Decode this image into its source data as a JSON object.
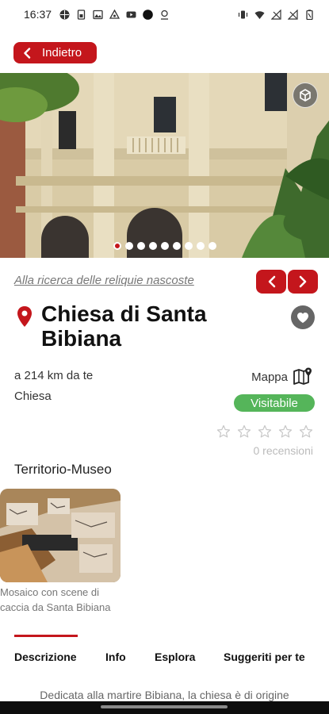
{
  "status_bar": {
    "time": "16:37",
    "left_icons": [
      "browser-icon",
      "sim-icon",
      "gallery-icon",
      "nfc-icon",
      "youtube-icon",
      "record-dot-icon",
      "location-icon"
    ],
    "right_icons": [
      "vibrate-icon",
      "wifi-icon",
      "signal-icon",
      "signal-2-icon",
      "battery-icon"
    ]
  },
  "back_button": {
    "label": "Indietro",
    "icon": "chevron-left-icon"
  },
  "carousel": {
    "total_images": 9,
    "active_index": 0,
    "fullscreen_icon": "cube-icon"
  },
  "route_link": "Alla ricerca delle reliquie nascoste",
  "poi": {
    "title": "Chiesa di Santa Bibiana",
    "distance": "a 214 km da te",
    "category": "Chiesa",
    "map_label": "Mappa",
    "status_badge": "Visitabile",
    "rating": 0,
    "max_rating": 5,
    "reviews": "0 recensioni"
  },
  "section": {
    "title": "Territorio-Museo",
    "items": [
      {
        "caption": "Mosaico con scene di caccia da Santa Bibiana"
      }
    ]
  },
  "tabs": [
    "Descrizione",
    "Info",
    "Esplora",
    "Suggeriti per te"
  ],
  "active_tab": 0,
  "description_preview": "Dedicata alla martire Bibiana, la chiesa è di origine",
  "colors": {
    "accent": "#c4161c",
    "badge_green": "#55b55a",
    "muted_text": "#777777"
  }
}
